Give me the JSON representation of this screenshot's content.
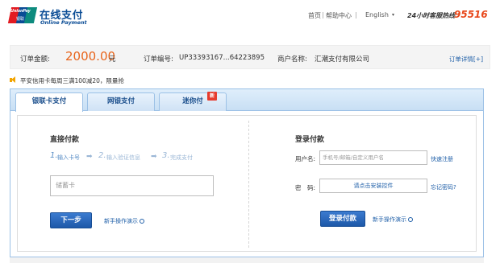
{
  "header": {
    "logo_text": "UnionPay",
    "logo_cn": "银联",
    "brand_cn": "在线支付",
    "brand_en": "Online Payment",
    "nav_home": "首页",
    "nav_sep": "|",
    "nav_help": "帮助中心",
    "nav_lang": "English",
    "nav_caret": "▾",
    "hotline_label": "24小时客服热线",
    "hotline_number": "95516"
  },
  "order": {
    "amount_label": "订单金额:",
    "amount_value": "2000.00",
    "amount_unit": "元",
    "order_no_label": "订单编号:",
    "order_no_value": "UP33393167...64223895",
    "merchant_label": "商户名称:",
    "merchant_value": "汇潮支付有限公司",
    "detail_link": "订单详情[+]"
  },
  "promo": {
    "text": "平安信用卡每周三满100减20，限量抢"
  },
  "tabs": [
    {
      "label": "银联卡支付",
      "active": true
    },
    {
      "label": "网银支付",
      "active": false
    },
    {
      "label": "迷你付",
      "active": false
    }
  ],
  "new_badge": "新",
  "direct": {
    "title": "直接付款",
    "steps": [
      {
        "num": "1.",
        "text": "输入卡号"
      },
      {
        "num": "2.",
        "text": "输入验证信息"
      },
      {
        "num": "3.",
        "text": "完成支付"
      }
    ],
    "arrow": "➡",
    "card_placeholder": "储蓄卡",
    "next_button": "下一步",
    "guide": "新手操作演示"
  },
  "login": {
    "title": "登录付款",
    "user_label": "用户名:",
    "user_placeholder": "手机号/邮箱/自定义用户名",
    "register_link": "快速注册",
    "pwd_label": "密　码:",
    "pwd_field_text": "请点击安装控件",
    "forgot_link": "忘记密码?",
    "login_button": "登录付款",
    "guide": "新手操作演示"
  },
  "colors": {
    "brand_blue": "#0a4c95",
    "amount_orange": "#e8641b",
    "hotline_orange": "#e8471a",
    "button_blue": "#1d58a8",
    "link_blue": "#1f5fa8"
  }
}
